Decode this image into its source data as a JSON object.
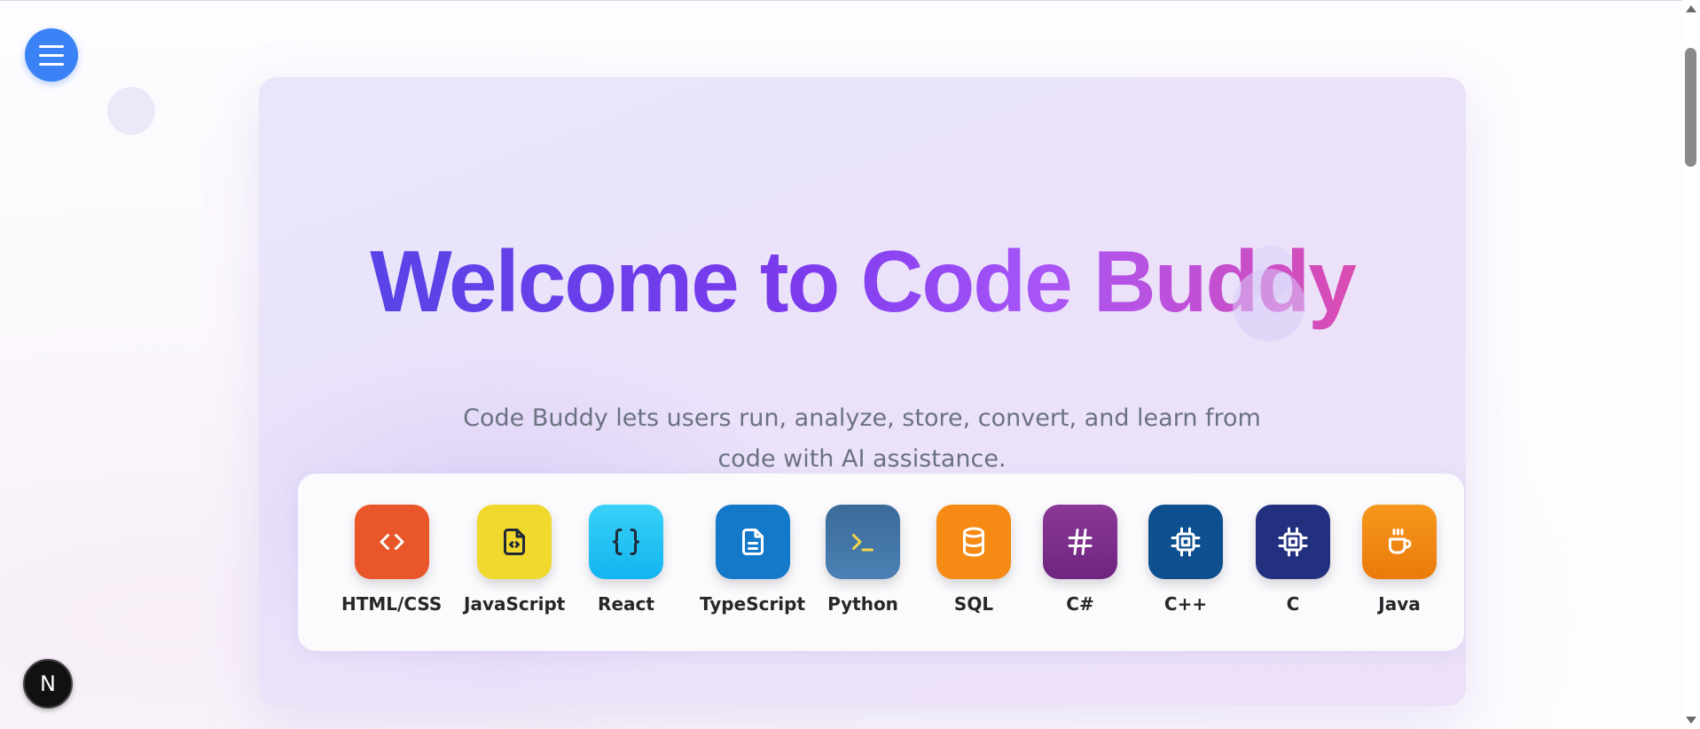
{
  "hero": {
    "title": "Welcome to Code Buddy",
    "subtitle": "Code Buddy lets users run, analyze, store, convert, and learn from code with AI assistance."
  },
  "languages": [
    {
      "label": "HTML/CSS",
      "icon": "code-brackets-icon",
      "color": "#e9562a"
    },
    {
      "label": "JavaScript",
      "icon": "js-file-icon",
      "color": "#f0d82c"
    },
    {
      "label": "React",
      "icon": "curly-braces-icon",
      "color": "#22c3f5"
    },
    {
      "label": "TypeScript",
      "icon": "document-icon",
      "color": "#1479c9"
    },
    {
      "label": "Python",
      "icon": "terminal-icon",
      "color": "#3e6fa0"
    },
    {
      "label": "SQL",
      "icon": "database-icon",
      "color": "#f58a14"
    },
    {
      "label": "C#",
      "icon": "hash-icon",
      "color": "#7d2f8c"
    },
    {
      "label": "C++",
      "icon": "cpu-chip-icon",
      "color": "#0d4f8f"
    },
    {
      "label": "C",
      "icon": "cpu-chip-icon",
      "color": "#23307f"
    },
    {
      "label": "Java",
      "icon": "coffee-cup-icon",
      "color": "#f0850f"
    }
  ],
  "dev_badge": {
    "letter": "N"
  },
  "colors": {
    "accent_blue": "#3b82f6",
    "title_gradient": [
      "#4f46e5",
      "#7c3aed",
      "#a855f7",
      "#ec4899"
    ],
    "subtitle": "#6b7280"
  }
}
